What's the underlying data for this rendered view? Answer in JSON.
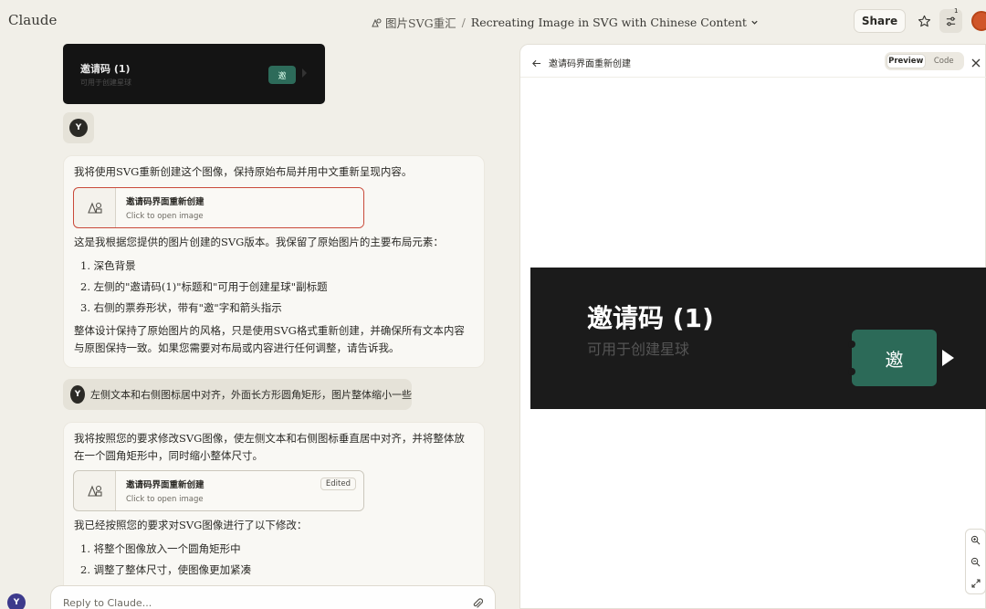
{
  "app": {
    "name": "Claude"
  },
  "header": {
    "project": "图片SVG重汇",
    "separator": "/",
    "chat_title": "Recreating Image in SVG with Chinese Content",
    "share_label": "Share",
    "settings_badge": "1"
  },
  "chat": {
    "top_preview": {
      "title": "邀请码 (1)",
      "subtitle": "可用于创建星球",
      "ticket": "邀"
    },
    "user_initial": "Y",
    "assistant_msg1": {
      "intro": "我将使用SVG重新创建这个图像，保持原始布局并用中文重新呈现内容。",
      "artifact": {
        "title": "邀请码界面重新创建",
        "subtitle": "Click to open image"
      },
      "para": "这是我根据您提供的图片创建的SVG版本。我保留了原始图片的主要布局元素：",
      "items": [
        "1. 深色背景",
        "2. 左侧的\"邀请码(1)\"标题和\"可用于创建星球\"副标题",
        "3. 右侧的票券形状，带有\"邀\"字和箭头指示"
      ],
      "outro_1": "整体设计保持了原始图片的风格，只是使用SVG格式重新创建，并确保所有文本内容",
      "outro_2": "与原图保持一致。如果您需要对布局或内容进行任何调整，请告诉我。"
    },
    "user_msg2": "左侧文本和右侧图标居中对齐，外面长方形圆角矩形，图片整体缩小一些",
    "assistant_msg2": {
      "intro_1": "我将按照您的要求修改SVG图像，使左侧文本和右侧图标垂直居中对齐，并将整体放",
      "intro_2": "在一个圆角矩形中，同时缩小整体尺寸。",
      "artifact": {
        "title": "邀请码界面重新创建",
        "subtitle": "Click to open image",
        "badge": "Edited"
      },
      "para": "我已经按照您的要求对SVG图像进行了以下修改：",
      "items": [
        "1. 将整个图像放入一个圆角矩形中",
        "2. 调整了整体尺寸，使图像更加紧凑"
      ]
    },
    "reply_placeholder": "Reply to Claude..."
  },
  "panel": {
    "title": "邀请码界面重新创建",
    "tabs": {
      "preview": "Preview",
      "code": "Code"
    },
    "canvas": {
      "title": "邀请码 (1)",
      "subtitle": "可用于创建星球",
      "ticket": "邀"
    }
  }
}
